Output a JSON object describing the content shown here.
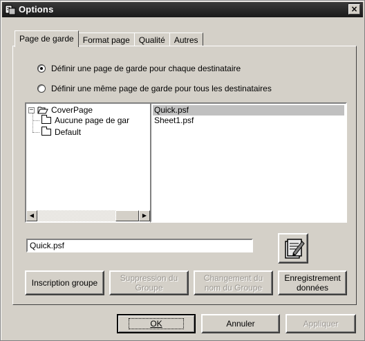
{
  "window": {
    "title": "Options",
    "close_glyph": "×"
  },
  "tabs": [
    {
      "label": "Page de garde",
      "active": true
    },
    {
      "label": "Format page",
      "active": false
    },
    {
      "label": "Qualité",
      "active": false
    },
    {
      "label": "Autres",
      "active": false
    }
  ],
  "radios": [
    {
      "label": "Définir une page de garde pour chaque destinataire",
      "checked": true
    },
    {
      "label": "Définir une même page de garde pour tous les destinataires",
      "checked": false
    }
  ],
  "tree": {
    "root": "CoverPage",
    "root_expander": "−",
    "children": [
      "Aucune page de gar",
      "Default"
    ],
    "scroll_left": "◀",
    "scroll_right": "▶"
  },
  "files": [
    {
      "name": "Quick.psf",
      "selected": true
    },
    {
      "name": "Sheet1.psf",
      "selected": false
    }
  ],
  "filename_field": {
    "value": "Quick.psf"
  },
  "actions": {
    "inscription": "Inscription groupe",
    "suppression": "Suppression du Groupe",
    "changement": "Changement du nom du Groupe",
    "enregistrement": "Enregistrement données"
  },
  "footer": {
    "ok": "OK",
    "annuler": "Annuler",
    "appliquer": "Appliquer"
  },
  "colors": {
    "face": "#d4d0c8",
    "titlebar": "#1a1a1a",
    "selection": "#c0c0c0",
    "disabled_text": "#9a9690"
  },
  "icons": {
    "window": "options-app-icon",
    "folder": "folder-icon",
    "open_folder": "open-folder-icon",
    "edit_cover": "notepad-edit-icon"
  }
}
